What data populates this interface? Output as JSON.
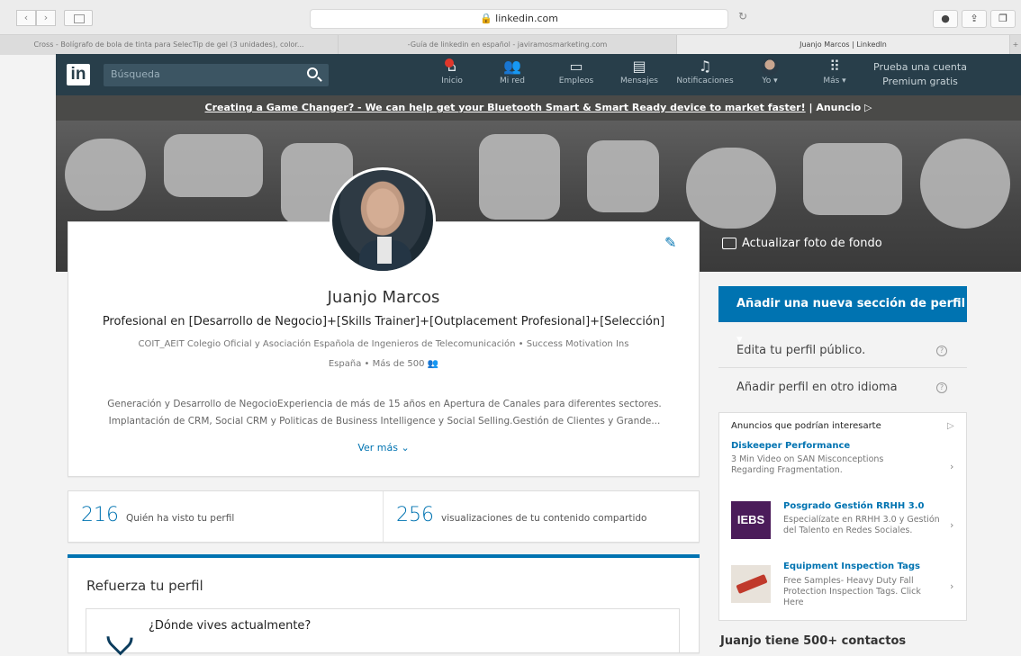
{
  "browser": {
    "url": "linkedin.com",
    "tabs": [
      "Cross - Bolígrafo de bola de tinta para SelecTip de gel (3 unidades), color...",
      "-Guía de linkedin en español - javiramosmarketing.com",
      "Juanjo Marcos | LinkedIn"
    ],
    "new_tab": "+"
  },
  "nav": {
    "logo": "in",
    "search_placeholder": "Búsqueda",
    "items": [
      {
        "label": "Inicio",
        "icon": "home-icon"
      },
      {
        "label": "Mi red",
        "icon": "network-icon"
      },
      {
        "label": "Empleos",
        "icon": "briefcase-icon"
      },
      {
        "label": "Mensajes",
        "icon": "messages-icon"
      },
      {
        "label": "Notificaciones",
        "icon": "bell-icon"
      },
      {
        "label": "Yo ▾",
        "icon": "avatar"
      },
      {
        "label": "Más ▾",
        "icon": "grid-icon"
      }
    ],
    "premium_line1": "Prueba una cuenta",
    "premium_line2": "Premium gratis"
  },
  "ad_strip": {
    "text": "Creating a Game Changer? - We can help get your Bluetooth Smart & Smart Ready device to market faster!",
    "tag": "Anuncio"
  },
  "hero": {
    "update_background": "Actualizar foto de fondo"
  },
  "profile": {
    "name": "Juanjo Marcos",
    "headline": "Profesional en [Desarrollo de Negocio]+[Skills Trainer]+[Outplacement Profesional]+[Selección]",
    "education": "COIT_AEIT Colegio Oficial y Asociación Española de Ingenieros de Telecomunicación • Success Motivation Ins",
    "location": "España • Más de 500",
    "summary_line1": "Generación y Desarrollo de NegocioExperiencia de más de 15 años en Apertura de Canales para diferentes sectores.",
    "summary_line2": "Implantación de CRM, Social CRM y Politicas de Business Intelligence y Social Selling.Gestión de Clientes y Grande...",
    "see_more": "Ver más"
  },
  "stats": [
    {
      "value": "216",
      "label": "Quién ha visto tu perfil"
    },
    {
      "value": "256",
      "label": "visualizaciones de tu contenido compartido"
    }
  ],
  "strengthen": {
    "title": "Refuerza tu perfil",
    "question": "¿Dónde vives actualmente?"
  },
  "right": {
    "add_section": "Añadir una nueva sección de perfil",
    "public_profile": "Edita tu perfil público.",
    "other_language": "Añadir perfil en otro idioma",
    "ads_header": "Anuncios que podrían interesarte",
    "ads": [
      {
        "title": "Diskeeper Performance",
        "desc": "3 Min Video on SAN Misconceptions Regarding Fragmentation."
      },
      {
        "title": "Posgrado Gestión RRHH 3.0",
        "desc": "Especialízate en RRHH 3.0 y Gestión del Talento en Redes Sociales.",
        "logo": "IEBS"
      },
      {
        "title": "Equipment Inspection Tags",
        "desc": "Free Samples- Heavy Duty Fall Protection Inspection Tags. Click Here"
      }
    ],
    "contacts": "Juanjo tiene 500+ contactos"
  }
}
